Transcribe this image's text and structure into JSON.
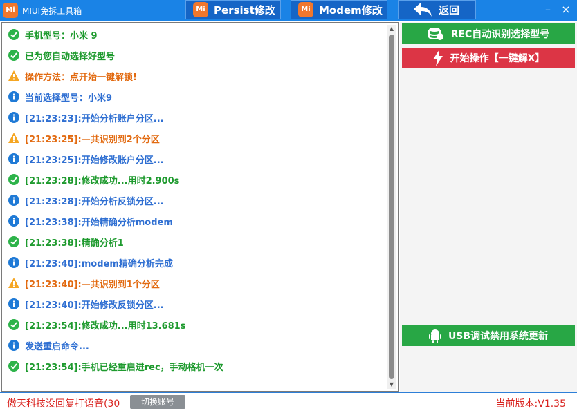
{
  "window": {
    "logo_text": "Mi",
    "title": "MIUI免拆工具箱",
    "tabs": [
      {
        "label": "Persist修改",
        "icon": "mi-logo-icon"
      },
      {
        "label": "Modem修改",
        "icon": "mi-logo-icon"
      },
      {
        "label": "返回",
        "icon": "back-arrow-icon"
      }
    ],
    "minimize": "–",
    "close": "×"
  },
  "log": [
    {
      "type": "success",
      "text": "手机型号：小米 9"
    },
    {
      "type": "success",
      "text": "已为您自动选择好型号"
    },
    {
      "type": "warning",
      "text": "操作方法：点开始一键解锁!"
    },
    {
      "type": "info",
      "text": "当前选择型号：小米9"
    },
    {
      "type": "info",
      "text": "[21:23:23]:开始分析账户分区..."
    },
    {
      "type": "warning",
      "text": "[21:23:25]:—共识别到2个分区"
    },
    {
      "type": "info",
      "text": "[21:23:25]:开始修改账户分区..."
    },
    {
      "type": "success",
      "text": "[21:23:28]:修改成功...用时2.900s"
    },
    {
      "type": "info",
      "text": "[21:23:28]:开始分析反锁分区..."
    },
    {
      "type": "info",
      "text": "[21:23:38]:开始精确分析modem"
    },
    {
      "type": "success",
      "text": "[21:23:38]:精确分析1"
    },
    {
      "type": "info",
      "text": "[21:23:40]:modem精确分析完成"
    },
    {
      "type": "warning",
      "text": "[21:23:40]:—共识别到1个分区"
    },
    {
      "type": "info",
      "text": "[21:23:40]:开始修改反锁分区..."
    },
    {
      "type": "success",
      "text": "[21:23:54]:修改成功...用时13.681s"
    },
    {
      "type": "info",
      "text": "发送重启命令..."
    },
    {
      "type": "success",
      "text": "[21:23:54]:手机已经重启进rec，手动格机一次"
    }
  ],
  "sidebar": {
    "rec_button": "REC自动识别选择型号",
    "start_button": "开始操作【一键解X】",
    "usb_button": "USB调试禁用系统更新"
  },
  "status": {
    "left_text": "傲天科技没回复打语音(30",
    "switch_account": "切换账号",
    "version": "当前版本:V1.35"
  },
  "colors": {
    "titlebar": "#1a83e6",
    "green": "#1e9a2e",
    "red": "#dc3545",
    "orange": "#e26a10",
    "blue": "#2f6fd2"
  }
}
